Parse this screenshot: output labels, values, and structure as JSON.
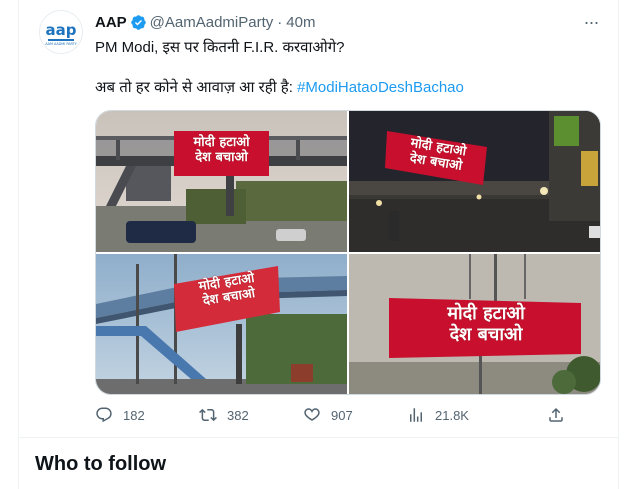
{
  "tweet": {
    "author_name": "AAP",
    "author_handle": "@AamAadmiParty",
    "separator": "·",
    "time": "40m",
    "line1": "PM Modi, इस पर कितनी F.I.R. करवाओगे?",
    "line2_prefix": "अब तो हर कोने से आवाज़ आ रही है: ",
    "hashtag": "#ModiHataoDeshBachao",
    "avatar_logo_text": "aap",
    "avatar_logo_subtext": "AAM AADMI PARTY",
    "more_label": "···"
  },
  "media": {
    "photos": [
      {
        "banner_line1": "मोदी हटाओ",
        "banner_line2": "देश बचाओ"
      },
      {
        "banner_line1": "मोदी हटाओ",
        "banner_line2": "देश बचाओ"
      },
      {
        "banner_line1": "मोदी हटाओ",
        "banner_line2": "देश बचाओ"
      },
      {
        "banner_line1": "मोदी हटाओ",
        "banner_line2": "देश बचाओ"
      }
    ]
  },
  "actions": {
    "replies": "182",
    "retweets": "382",
    "likes": "907",
    "views": "21.8K"
  },
  "sidebar": {
    "who_to_follow": "Who to follow"
  },
  "colors": {
    "accent": "#1d9bf0",
    "banner_red": "#c8102e",
    "muted": "#536471"
  }
}
